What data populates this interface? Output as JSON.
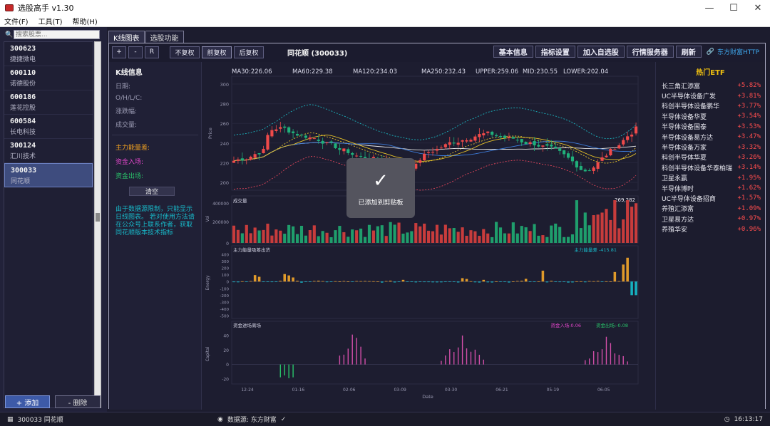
{
  "window": {
    "title": "选股高手 v1.30"
  },
  "menu": [
    "文件(F)",
    "工具(T)",
    "帮助(H)"
  ],
  "search": {
    "placeholder": "搜索股票..."
  },
  "stocks": [
    {
      "code": "300623",
      "name": "捷捷微电"
    },
    {
      "code": "600110",
      "name": "诺德股份"
    },
    {
      "code": "600186",
      "name": "莲花控股"
    },
    {
      "code": "600584",
      "name": "长电科技"
    },
    {
      "code": "300124",
      "name": "汇川技术"
    },
    {
      "code": "300033",
      "name": "同花顺"
    }
  ],
  "left_buttons": {
    "add": "+ 添加",
    "delete": "- 删除"
  },
  "tabs": [
    "K线图表",
    "选股功能"
  ],
  "toolbar": {
    "zoom_in": "+",
    "zoom_out": "-",
    "reset": "R",
    "adj_none": "不复权",
    "adj_forward": "前复权",
    "adj_backward": "后复权",
    "stock_title": "同花顺 (300033)",
    "basic_info": "基本信息",
    "indicator_settings": "指标设置",
    "add_watch": "加入自选股",
    "quote_server": "行情服务器",
    "refresh": "刷新",
    "source_link": "东方财富HTTP"
  },
  "kline_info": {
    "title": "K线信息",
    "fields": [
      "日期:",
      "O/H/L/C:",
      "涨跌幅:",
      "成交量:"
    ],
    "main_flow": "主力能量差:",
    "cap_in": "资金入场:",
    "cap_out": "资金出场:",
    "clear": "清空",
    "notice": "由于数据源限制，只能显示日线图表。 若对使用方法请在公众号上联系作者，获取同花顺版本技术指标"
  },
  "ma_labels": [
    {
      "text": "MA30:226.06",
      "color": "#e6c229"
    },
    {
      "text": "MA60:229.38",
      "color": "#3d7bd8"
    },
    {
      "text": "MA120:234.03",
      "color": "#e8e8e8"
    },
    {
      "text": "MA250:232.43",
      "color": "#c96ad8"
    },
    {
      "text": "UPPER:259.06",
      "color": "#1bb5bf"
    },
    {
      "text": "MID:230.55",
      "color": "#e6c229"
    },
    {
      "text": "LOWER:202.04",
      "color": "#e0455a"
    }
  ],
  "chart_data": {
    "type": "candlestick",
    "ylabel": "Price",
    "price_ticks": [
      200,
      220,
      240,
      260,
      280,
      300
    ],
    "ylim": [
      192,
      308
    ],
    "xlabel": "Date",
    "x_ticks": [
      "12-24",
      "01-16",
      "02-06",
      "03-09",
      "03-30",
      "06-21",
      "05-19",
      "06-05"
    ],
    "volume": {
      "label": "成交量",
      "ylabel": "Vol",
      "ticks": [
        "400000",
        "200000",
        "0"
      ],
      "last_value": "269,282"
    },
    "energy": {
      "label": "主力能量吸筹出货",
      "ylabel": "Energy",
      "ticks": [
        400,
        300,
        200,
        100,
        0,
        -100,
        -200,
        -300,
        -400,
        -500
      ],
      "readout": "主力能量差 -415.81"
    },
    "capital": {
      "label": "资金进场离场",
      "ylabel": "Capital",
      "ticks": [
        40,
        20,
        0,
        -20
      ],
      "in_readout": "资金入场:0.06",
      "out_readout": "资金出场:-0.08"
    }
  },
  "hot_etf": {
    "title": "热门ETF",
    "items": [
      {
        "name": "长三角汇添富",
        "pct": "+5.82%"
      },
      {
        "name": "UC半导体设备广发",
        "pct": "+3.81%"
      },
      {
        "name": "科创半导体设备鹏华",
        "pct": "+3.77%"
      },
      {
        "name": "半导体设备华夏",
        "pct": "+3.54%"
      },
      {
        "name": "半导体设备国泰",
        "pct": "+3.53%"
      },
      {
        "name": "半导体设备易方达",
        "pct": "+3.47%"
      },
      {
        "name": "半导体设备万家",
        "pct": "+3.32%"
      },
      {
        "name": "科创半导体华夏",
        "pct": "+3.26%"
      },
      {
        "name": "科创半导体设备华泰柏瑞",
        "pct": "+3.14%"
      },
      {
        "name": "卫星永赢",
        "pct": "+1.95%"
      },
      {
        "name": "半导体博时",
        "pct": "+1.62%"
      },
      {
        "name": "UC半导体设备招商",
        "pct": "+1.57%"
      },
      {
        "name": "养殖汇添富",
        "pct": "+1.09%"
      },
      {
        "name": "卫星易方达",
        "pct": "+0.97%"
      },
      {
        "name": "养殖华安",
        "pct": "+0.96%"
      }
    ]
  },
  "toast": {
    "message": "已添加到剪贴板"
  },
  "status": {
    "stock": "300033 同花顺",
    "source": "数据源: 东方财富",
    "time": "16:13:17"
  }
}
